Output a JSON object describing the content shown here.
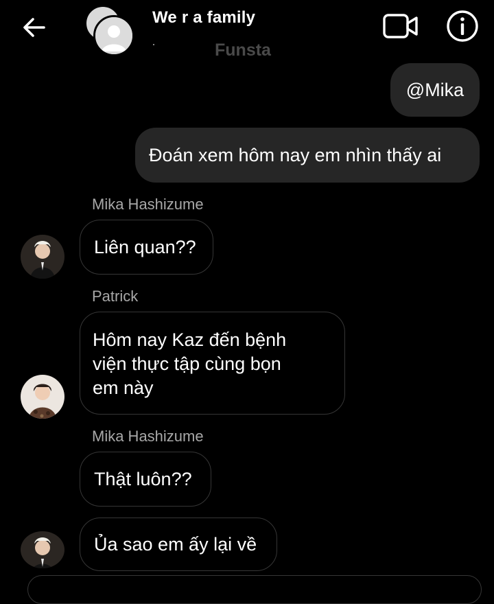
{
  "header": {
    "title": "We r a family",
    "subtitle": "Funsta"
  },
  "messages": {
    "out1": "@Mika",
    "out2": "Đoán xem hôm nay em nhìn thấy ai",
    "mika1_sender": "Mika Hashizume",
    "mika1_text": "Liên quan??",
    "patrick_sender": "Patrick",
    "patrick_lines": [
      "Hôm nay Kaz đến bệnh",
      "viện thực tập cùng bọn",
      "em này"
    ],
    "mika2_sender": "Mika Hashizume",
    "mika2_text": "Thật luôn??",
    "mika3_text": "Ủa sao em ấy lại về"
  },
  "colors": {
    "background": "#000000",
    "outgoing_bubble": "#262626",
    "incoming_border": "#363636",
    "sender_name": "#a8a8a8"
  },
  "icons": [
    "back-arrow-icon",
    "video-call-icon",
    "info-icon"
  ]
}
